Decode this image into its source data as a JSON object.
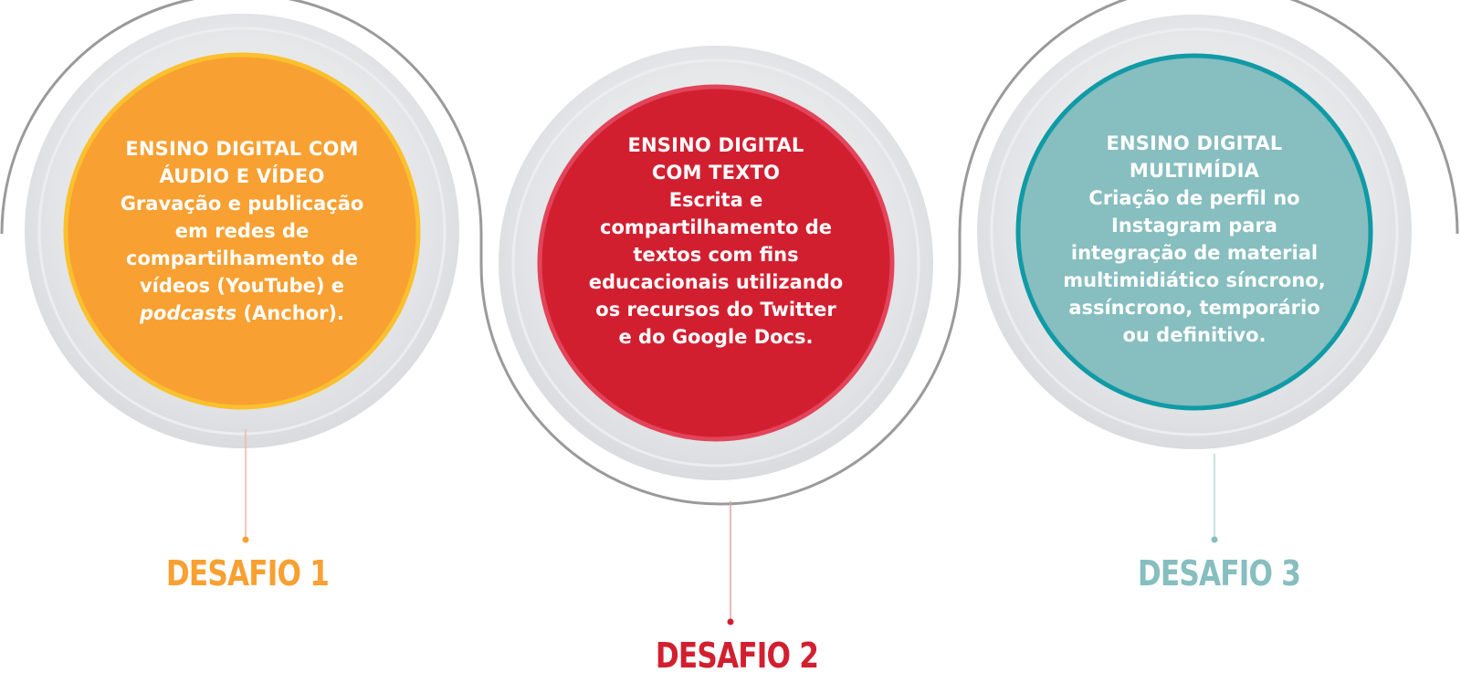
{
  "colors": {
    "orange": "#F8A031",
    "orange_ring": "#FBC02D",
    "red": "#D21F30",
    "red_ring": "#E2445A",
    "teal": "#87BEBF",
    "teal_ring": "#109AA6",
    "halo": "#E1E3E6",
    "arc": "#9A9A9A"
  },
  "desafios": [
    {
      "heading_line1": "ENSINO DIGITAL COM",
      "heading_line2": "ÁUDIO E VÍDEO",
      "body_lines": [
        "Gravação e publicação",
        "em redes de",
        "compartilhamento de",
        "vídeos (YouTube) e"
      ],
      "last_line_italic": "podcasts",
      "last_line_rest": " (Anchor).",
      "label": "DESAFIO 1"
    },
    {
      "heading_line1": "ENSINO DIGITAL",
      "heading_line2": "COM TEXTO",
      "body_lines": [
        "Escrita e",
        "compartilhamento de",
        "textos com fins",
        "educacionais utilizando",
        "os recursos do Twitter",
        "e do Google Docs."
      ],
      "label": "DESAFIO 2"
    },
    {
      "heading_line1": "ENSINO DIGITAL",
      "heading_line2": "MULTIMÍDIA",
      "body_lines": [
        "Criação de perfil no",
        "Instagram para",
        "integração de material",
        "multimidiático síncrono,",
        "assíncrono, temporário",
        "ou definitivo."
      ],
      "label": "DESAFIO 3"
    }
  ]
}
